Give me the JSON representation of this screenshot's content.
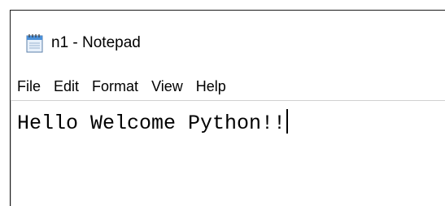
{
  "window": {
    "title": "n1 - Notepad",
    "app_icon": "notepad-icon"
  },
  "menu": {
    "items": [
      "File",
      "Edit",
      "Format",
      "View",
      "Help"
    ]
  },
  "editor": {
    "content": "Hello Welcome Python!!"
  },
  "colors": {
    "background": "#ffffff",
    "text": "#000000",
    "icon_blue": "#4a90d9"
  }
}
